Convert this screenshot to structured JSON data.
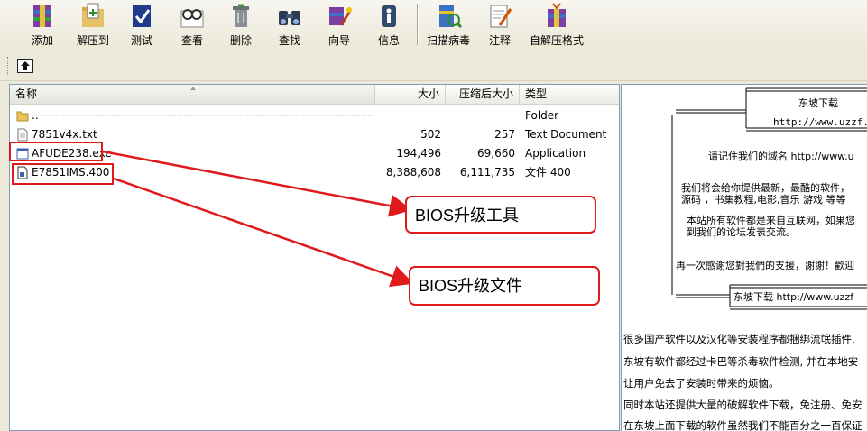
{
  "toolbar": {
    "buttons": [
      {
        "label": "添加",
        "icon": "add-archive-icon"
      },
      {
        "label": "解压到",
        "icon": "extract-to-icon"
      },
      {
        "label": "测试",
        "icon": "test-icon"
      },
      {
        "label": "查看",
        "icon": "view-icon"
      },
      {
        "label": "删除",
        "icon": "delete-icon"
      },
      {
        "label": "查找",
        "icon": "find-icon"
      },
      {
        "label": "向导",
        "icon": "wizard-icon"
      },
      {
        "label": "信息",
        "icon": "info-icon"
      },
      {
        "label": "扫描病毒",
        "icon": "scan-virus-icon"
      },
      {
        "label": "注释",
        "icon": "comment-icon"
      },
      {
        "label": "自解压格式",
        "icon": "sfx-icon"
      }
    ]
  },
  "filelist": {
    "columns": {
      "name": "名称",
      "size": "大小",
      "packed": "压缩后大小",
      "type": "类型"
    },
    "rows": [
      {
        "name": "..",
        "size": "",
        "packed": "",
        "type": "Folder",
        "icon": "folder-icon"
      },
      {
        "name": "7851v4x.txt",
        "size": "502",
        "packed": "257",
        "type": "Text Document",
        "icon": "text-file-icon"
      },
      {
        "name": "AFUDE238.exe",
        "size": "194,496",
        "packed": "69,660",
        "type": "Application",
        "icon": "application-icon"
      },
      {
        "name": "E7851IMS.400",
        "size": "8,388,608",
        "packed": "6,111,735",
        "type": "文件 400",
        "icon": "generic-file-icon"
      }
    ]
  },
  "comment": {
    "box_title": "东坡下载",
    "box_url": "http://www.uzzf.c",
    "line1": "请记住我们的域名 http://www.u",
    "line2a": "我们将会给你提供最新，最酷的软件，",
    "line2b": "源码 ，书集教程,电影,音乐 游戏 等等",
    "line3a": "本站所有软件都是来自互联网，如果您",
    "line3b": "到我们的论坛发表交流。",
    "line4": "再一次感谢您對我們的支援，謝謝！歡迎",
    "footer": "东坡下载 http://www.uzzf",
    "para1a": "很多国产软件以及汉化等安装程序都捆绑流氓插件,",
    "para1b": "东坡有软件都经过卡巴等杀毒软件检测, 并在本地安",
    "para1c": "让用户免去了安装时带来的烦恼。",
    "para2a": "同时本站还提供大量的破解软件下载，免注册、免安",
    "para2b": "在东坡上面下载的软件虽然我们不能百分之一百保证"
  },
  "annotations": {
    "tool_label": "BIOS升级工具",
    "file_label": "BIOS升级文件"
  },
  "colors": {
    "accent": "#e0191c"
  }
}
